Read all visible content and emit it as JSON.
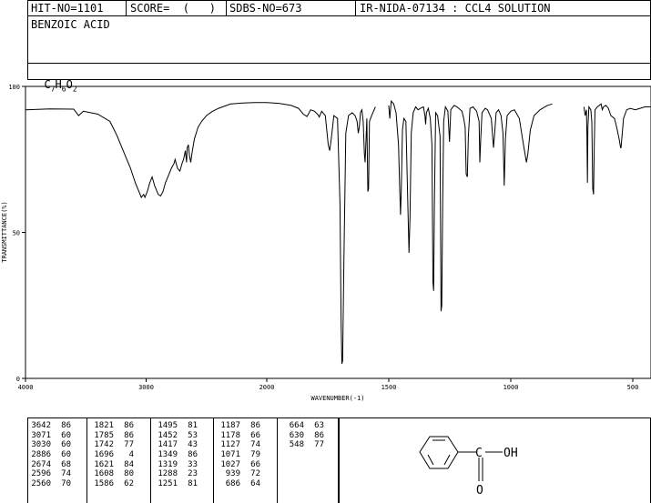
{
  "header": {
    "hit_no": "HIT-NO=1101",
    "score": "SCORE=  (   )",
    "sdbs_no": "SDBS-NO=673",
    "ir_info": "IR-NIDA-07134 : CCL4 SOLUTION",
    "compound_name": "BENZOIC ACID",
    "formula_parts": [
      "C",
      "7",
      "H",
      "6",
      "O",
      "2"
    ]
  },
  "chart_data": {
    "type": "line",
    "xlabel": "WAVENUMBER(-1)",
    "ylabel": "TRANSMITTANCE(%)",
    "xlim": [
      4000,
      400
    ],
    "ylim": [
      0,
      100
    ],
    "x_ticks": [
      4000,
      3000,
      2000,
      1500,
      1000,
      500
    ],
    "y_ticks": [
      0,
      50,
      100
    ],
    "x_tick_labels": [
      "4000",
      "3000",
      "2000",
      "1500",
      "1000",
      "500"
    ],
    "y_tick_labels": [
      "0",
      "50",
      "100"
    ],
    "series": [
      {
        "segments": [
          [
            [
              4000,
              92
            ],
            [
              3800,
              92.3
            ],
            [
              3600,
              92.2
            ],
            [
              3560,
              90
            ],
            [
              3520,
              91.5
            ],
            [
              3400,
              90.5
            ],
            [
              3300,
              88
            ],
            [
              3240,
              83
            ],
            [
              3180,
              77
            ],
            [
              3130,
              72
            ],
            [
              3090,
              67
            ],
            [
              3060,
              64
            ],
            [
              3040,
              62
            ],
            [
              3020,
              63
            ],
            [
              3010,
              62
            ],
            [
              2990,
              64
            ],
            [
              2970,
              67
            ],
            [
              2950,
              69
            ],
            [
              2930,
              66
            ],
            [
              2900,
              63
            ],
            [
              2880,
              62.5
            ],
            [
              2860,
              64
            ],
            [
              2840,
              67
            ],
            [
              2810,
              70
            ],
            [
              2790,
              72
            ],
            [
              2770,
              73.5
            ],
            [
              2760,
              75
            ],
            [
              2740,
              72
            ],
            [
              2720,
              71
            ],
            [
              2700,
              74
            ],
            [
              2690,
              75
            ],
            [
              2675,
              78
            ],
            [
              2665,
              74
            ],
            [
              2660,
              79
            ],
            [
              2650,
              80
            ],
            [
              2640,
              76
            ],
            [
              2630,
              74
            ],
            [
              2620,
              77
            ],
            [
              2600,
              82
            ],
            [
              2570,
              86
            ],
            [
              2540,
              88
            ],
            [
              2500,
              90
            ],
            [
              2450,
              91.5
            ],
            [
              2400,
              92.5
            ],
            [
              2300,
              94
            ],
            [
              2200,
              94.3
            ],
            [
              2100,
              94.5
            ],
            [
              2000,
              94.5
            ],
            [
              1950,
              94.2
            ],
            [
              1900,
              93.5
            ],
            [
              1870,
              92.5
            ],
            [
              1850,
              90.5
            ],
            [
              1835,
              89.7
            ],
            [
              1820,
              92
            ],
            [
              1805,
              91.5
            ],
            [
              1790,
              90.3
            ],
            [
              1785,
              89.5
            ],
            [
              1775,
              91.5
            ],
            [
              1760,
              90
            ],
            [
              1748,
              80
            ],
            [
              1742,
              78
            ],
            [
              1736,
              82
            ],
            [
              1725,
              90
            ],
            [
              1710,
              89
            ],
            [
              1700,
              60
            ],
            [
              1695,
              18
            ],
            [
              1692,
              5
            ],
            [
              1689,
              6
            ],
            [
              1684,
              40
            ],
            [
              1676,
              84
            ],
            [
              1665,
              90
            ],
            [
              1650,
              91
            ],
            [
              1638,
              90
            ],
            [
              1630,
              88
            ],
            [
              1625,
              84
            ],
            [
              1621,
              86
            ],
            [
              1616,
              91
            ],
            [
              1610,
              92
            ],
            [
              1605,
              88
            ],
            [
              1600,
              77
            ],
            [
              1597,
              74
            ],
            [
              1594,
              80
            ],
            [
              1590,
              89
            ],
            [
              1586,
              64
            ],
            [
              1583,
              65
            ],
            [
              1579,
              88
            ],
            [
              1570,
              90
            ],
            [
              1555,
              93
            ]
          ],
          [
            [
              1500,
              93.5
            ],
            [
              1496,
              89
            ],
            [
              1490,
              95
            ],
            [
              1480,
              94
            ],
            [
              1470,
              91
            ],
            [
              1460,
              80
            ],
            [
              1455,
              64
            ],
            [
              1452,
              56
            ],
            [
              1449,
              64
            ],
            [
              1444,
              85
            ],
            [
              1438,
              89
            ],
            [
              1430,
              88
            ],
            [
              1422,
              60
            ],
            [
              1417,
              43
            ],
            [
              1413,
              55
            ],
            [
              1408,
              84
            ],
            [
              1400,
              91
            ],
            [
              1390,
              93
            ],
            [
              1380,
              92
            ],
            [
              1370,
              92.5
            ],
            [
              1358,
              93
            ],
            [
              1352,
              90
            ],
            [
              1349,
              87
            ],
            [
              1346,
              91
            ],
            [
              1338,
              92.5
            ],
            [
              1330,
              89
            ],
            [
              1323,
              80
            ],
            [
              1319,
              33
            ],
            [
              1316,
              30
            ],
            [
              1313,
              60
            ],
            [
              1308,
              91
            ],
            [
              1300,
              90
            ],
            [
              1290,
              83
            ],
            [
              1286,
              23
            ],
            [
              1283,
              25
            ],
            [
              1279,
              60
            ],
            [
              1275,
              88
            ],
            [
              1268,
              93
            ],
            [
              1258,
              91.5
            ],
            [
              1251,
              81
            ],
            [
              1246,
              92
            ],
            [
              1232,
              93.5
            ],
            [
              1220,
              93
            ],
            [
              1200,
              91.5
            ],
            [
              1193,
              89
            ],
            [
              1187,
              86
            ],
            [
              1183,
              70
            ],
            [
              1178,
              69
            ],
            [
              1174,
              83
            ],
            [
              1167,
              92.5
            ],
            [
              1155,
              93
            ],
            [
              1140,
              91.5
            ],
            [
              1130,
              88
            ],
            [
              1127,
              74
            ],
            [
              1123,
              82
            ],
            [
              1118,
              91
            ],
            [
              1105,
              92.5
            ],
            [
              1095,
              92
            ],
            [
              1080,
              89
            ],
            [
              1071,
              79
            ],
            [
              1066,
              84
            ],
            [
              1060,
              91
            ],
            [
              1050,
              92
            ],
            [
              1040,
              90
            ],
            [
              1032,
              84
            ],
            [
              1027,
              66
            ],
            [
              1022,
              82
            ],
            [
              1015,
              90
            ],
            [
              1000,
              91.5
            ],
            [
              985,
              92
            ],
            [
              965,
              89
            ],
            [
              952,
              82
            ],
            [
              940,
              76
            ],
            [
              936,
              74
            ],
            [
              930,
              77
            ],
            [
              920,
              85
            ],
            [
              905,
              90
            ],
            [
              880,
              92
            ],
            [
              850,
              93.5
            ],
            [
              830,
              94
            ]
          ],
          [
            [
              700,
              93
            ],
            [
              695,
              90
            ],
            [
              690,
              92
            ],
            [
              688,
              84
            ],
            [
              686,
              67
            ],
            [
              684,
              86
            ],
            [
              680,
              93
            ],
            [
              672,
              92
            ],
            [
              668,
              88
            ],
            [
              664,
              65
            ],
            [
              661,
              63
            ],
            [
              658,
              80
            ],
            [
              655,
              92
            ],
            [
              645,
              93
            ],
            [
              630,
              94
            ],
            [
              625,
              92
            ],
            [
              620,
              93
            ],
            [
              610,
              93.5
            ],
            [
              600,
              92.5
            ],
            [
              590,
              90
            ],
            [
              575,
              89
            ],
            [
              566,
              86
            ],
            [
              556,
              82
            ],
            [
              550,
              79
            ],
            [
              548,
              79
            ],
            [
              545,
              82
            ],
            [
              538,
              89
            ],
            [
              525,
              92
            ],
            [
              510,
              92.5
            ],
            [
              490,
              92
            ],
            [
              470,
              92.5
            ],
            [
              450,
              93
            ],
            [
              420,
              93
            ],
            [
              400,
              92.5
            ]
          ]
        ]
      }
    ],
    "peak_table": [
      [
        [
          "3642",
          "86"
        ],
        [
          "3071",
          "60"
        ],
        [
          "3030",
          "60"
        ],
        [
          "2886",
          "60"
        ],
        [
          "2674",
          "68"
        ],
        [
          "2596",
          "74"
        ],
        [
          "2560",
          "70"
        ]
      ],
      [
        [
          "1821",
          "86"
        ],
        [
          "1785",
          "86"
        ],
        [
          "1742",
          "77"
        ],
        [
          "1696",
          "4"
        ],
        [
          "1621",
          "84"
        ],
        [
          "1608",
          "80"
        ],
        [
          "1586",
          "62"
        ]
      ],
      [
        [
          "1495",
          "81"
        ],
        [
          "1452",
          "53"
        ],
        [
          "1417",
          "43"
        ],
        [
          "1349",
          "86"
        ],
        [
          "1319",
          "33"
        ],
        [
          "1288",
          "23"
        ],
        [
          "1251",
          "81"
        ]
      ],
      [
        [
          "1187",
          "86"
        ],
        [
          "1178",
          "66"
        ],
        [
          "1127",
          "74"
        ],
        [
          "1071",
          "79"
        ],
        [
          "1027",
          "66"
        ],
        [
          "939",
          "72"
        ],
        [
          "686",
          "64"
        ]
      ],
      [
        [
          "664",
          "63"
        ],
        [
          "630",
          "86"
        ],
        [
          "548",
          "77"
        ]
      ]
    ],
    "structure_label": "OH",
    "structure_label_o": "O"
  }
}
